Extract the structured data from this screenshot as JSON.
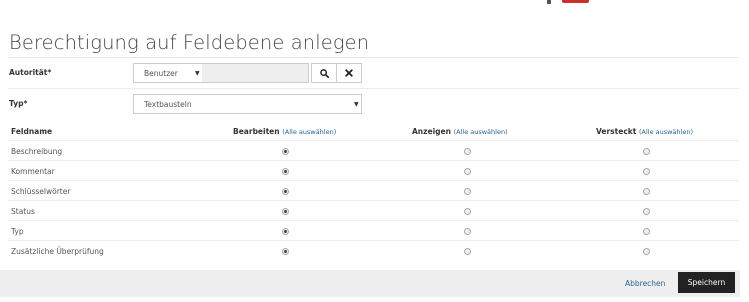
{
  "page": {
    "title": "Berechtigung auf Feldebene anlegen"
  },
  "form": {
    "authority": {
      "label": "Autorität*",
      "type_select": "Benutzer",
      "value": "",
      "search_icon": "search-icon",
      "clear_icon": "close-icon"
    },
    "type": {
      "label": "Typ*",
      "value": "Textbausteln"
    }
  },
  "table": {
    "headers": {
      "field": "Feldname",
      "edit": "Bearbeiten",
      "view": "Anzeigen",
      "hidden": "Versteckt",
      "select_all": "(Alle auswählen)"
    },
    "rows": [
      {
        "name": "Beschreibung",
        "selected": "edit"
      },
      {
        "name": "Kommentar",
        "selected": "edit"
      },
      {
        "name": "Schlüsselwörter",
        "selected": "edit"
      },
      {
        "name": "Status",
        "selected": "edit"
      },
      {
        "name": "Typ",
        "selected": "edit"
      },
      {
        "name": "Zusätzliche Überprüfung",
        "selected": "edit"
      }
    ]
  },
  "footer": {
    "cancel_label": "Abbrechen",
    "save_label": "Speichern"
  }
}
